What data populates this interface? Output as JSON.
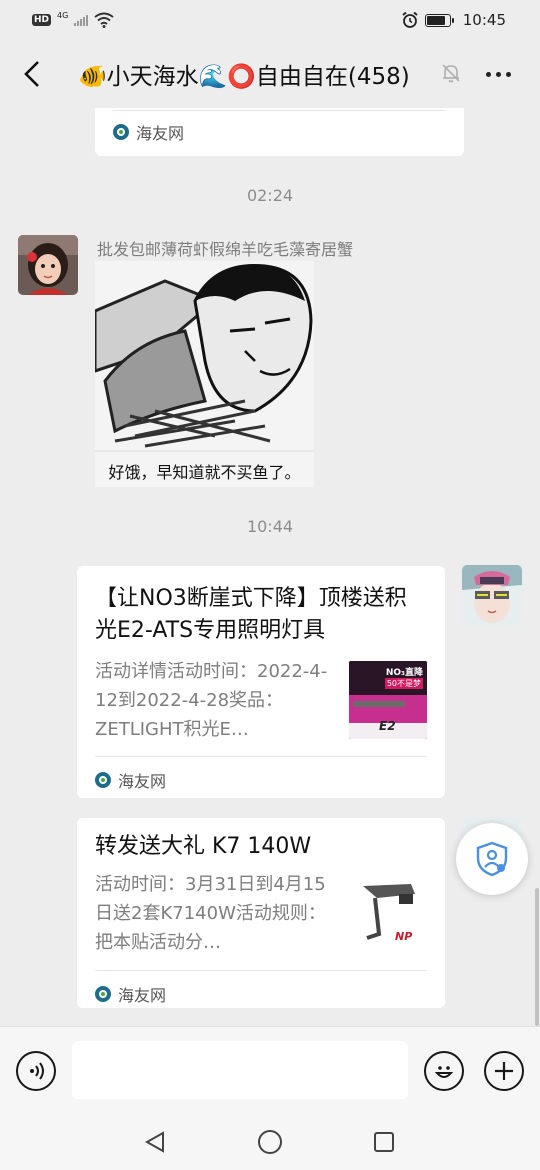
{
  "status_bar": {
    "hd": "HD",
    "network": "4G",
    "time": "10:45"
  },
  "header": {
    "title": "🐠小天海水🌊⭕自由自在(458)",
    "icons": [
      "back-arrow-icon",
      "mute-bell-icon",
      "more-icon"
    ]
  },
  "messages": {
    "top_card": {
      "source": "海友网"
    },
    "timestamp_1": "02:24",
    "image_msg": {
      "sender": "批发包邮薄荷虾假绵羊吃毛藻寄居蟹",
      "caption": "好饿，早知道就不买鱼了。"
    },
    "timestamp_2": "10:44",
    "card_1": {
      "title": "【让NO3断崖式下降】顶楼送积光E2-ATS专用照明灯具",
      "description": "活动详情活动时间：2022-4-12到2022-4-28奖品：ZETLIGHT积光E…",
      "thumb_text_1": "NO₃直降",
      "thumb_text_2": "50不是梦",
      "thumb_text_3": "E2",
      "source": "海友网"
    },
    "card_2": {
      "title": "转发送大礼 K7 140W",
      "description": "活动时间：3月31日到4月15日送2套K7140W活动规则：把本贴活动分…",
      "thumb_text": "NP",
      "source": "海友网"
    }
  },
  "colors": {
    "background": "#ededed",
    "card": "#ffffff",
    "source_icon": "#1f6b8a",
    "float_icon": "#4a8fe0"
  },
  "input_bar": {
    "icons": [
      "voice-icon",
      "emoji-icon",
      "add-icon"
    ]
  },
  "nav_bar": {
    "icons": [
      "nav-back-icon",
      "nav-home-icon",
      "nav-recents-icon"
    ]
  }
}
